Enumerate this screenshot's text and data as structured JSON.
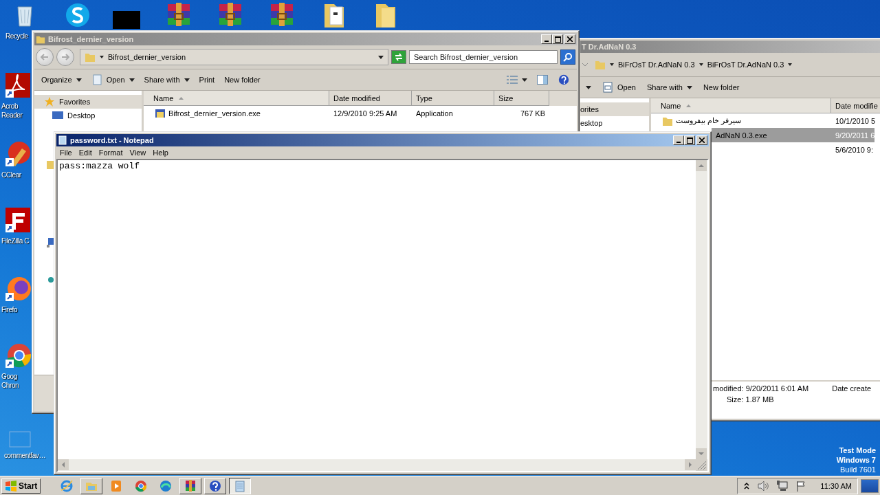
{
  "desktop_icons": [
    {
      "kind": "recycle-bin",
      "label_lines": [
        "Recycle"
      ]
    },
    {
      "kind": "chat-app"
    },
    {
      "kind": "tile"
    },
    {
      "kind": "archive"
    },
    {
      "kind": "archive"
    },
    {
      "kind": "archive"
    },
    {
      "kind": "folder-document"
    },
    {
      "kind": "folder"
    },
    {
      "kind": "pdf-reader",
      "label_lines": [
        "Acrob",
        "Reader"
      ]
    },
    {
      "kind": "cleaner",
      "label_lines": [
        "CClear"
      ]
    },
    {
      "kind": "ftp-app",
      "label_lines": [
        "FileZilla C"
      ]
    },
    {
      "kind": "fox-browser",
      "label_lines": [
        "Firefo"
      ]
    },
    {
      "kind": "ring-browser",
      "label_lines": [
        "Goog",
        "Chron"
      ]
    },
    {
      "kind": "blank",
      "label_lines": [
        "commentfav…"
      ]
    }
  ],
  "explorer_back": {
    "title": "T Dr.AdNaN 0.3",
    "active": false,
    "breadcrumb": [
      "BiFrOsT Dr.AdNaN 0.3",
      "BiFrOsT Dr.AdNaN 0.3"
    ],
    "toolbar": [
      {
        "dropdown": true
      },
      {
        "label": "Open",
        "dropdown": false
      },
      {
        "label": "Share with",
        "dropdown": true
      },
      {
        "label": "New folder",
        "dropdown": false
      }
    ],
    "nav_items": [
      {
        "label": "orites",
        "kind": "header"
      },
      {
        "label": "esktop",
        "kind": "item"
      }
    ],
    "columns": [
      {
        "label": "Name",
        "sorted": true
      },
      {
        "label": "Date modifie"
      }
    ],
    "rows": [
      {
        "kind": "folder",
        "name": "سيرفر خام بيفروست",
        "date": "10/1/2010 5",
        "selected": false
      },
      {
        "kind": "file",
        "name": "AdNaN 0.3.exe",
        "date": "9/20/2011 6",
        "selected": true
      },
      {
        "kind": "hidden",
        "date": "5/6/2010 9:",
        "selected": false
      }
    ],
    "details": {
      "modified": "modified: 9/20/2011 6:01 AM",
      "date_created": "Date create",
      "size": "Size: 1.87 MB"
    }
  },
  "explorer": {
    "title": "Bifrost_dernier_version",
    "active": false,
    "address": "Bifrost_dernier_version",
    "search_placeholder": "Search Bifrost_dernier_version",
    "toolbar": [
      {
        "label": "Organize",
        "dropdown": true
      },
      {
        "label": "Open",
        "dropdown": true
      },
      {
        "label": "Share with",
        "dropdown": true
      },
      {
        "label": "Print",
        "dropdown": false
      },
      {
        "label": "New folder",
        "dropdown": false
      }
    ],
    "nav_items": [
      {
        "label": "Favorites",
        "kind": "header"
      },
      {
        "label": "Desktop",
        "kind": "item"
      }
    ],
    "columns": [
      {
        "label": "Name",
        "sorted": true
      },
      {
        "label": "Date modified",
        "sorted": false
      },
      {
        "label": "Type",
        "sorted": false
      },
      {
        "label": "Size",
        "sorted": false
      }
    ],
    "rows": [
      {
        "name": "Bifrost_dernier_version.exe",
        "date": "12/9/2010 9:25 AM",
        "type": "Application",
        "size": "767 KB",
        "selected": false
      }
    ]
  },
  "notepad": {
    "title": "password.txt - Notepad",
    "active": true,
    "menu": [
      "File",
      "Edit",
      "Format",
      "View",
      "Help"
    ],
    "text": "pass:mazza wolf"
  },
  "system_text": [
    "Test Mode",
    "Windows 7",
    "Build 7601"
  ],
  "taskbar": {
    "start": "Start",
    "items": [
      {
        "kind": "web-browser",
        "running": false,
        "selected": false
      },
      {
        "kind": "file-manager",
        "running": true,
        "selected": false
      },
      {
        "kind": "media-player",
        "running": false,
        "selected": false
      },
      {
        "kind": "ring-browser",
        "running": false,
        "selected": false
      },
      {
        "kind": "wave-browser",
        "running": false,
        "selected": false
      },
      {
        "kind": "archive",
        "running": true,
        "selected": false
      },
      {
        "kind": "help",
        "running": true,
        "selected": false
      },
      {
        "kind": "notepad",
        "running": true,
        "selected": true
      }
    ],
    "clock": "11:30 AM"
  }
}
